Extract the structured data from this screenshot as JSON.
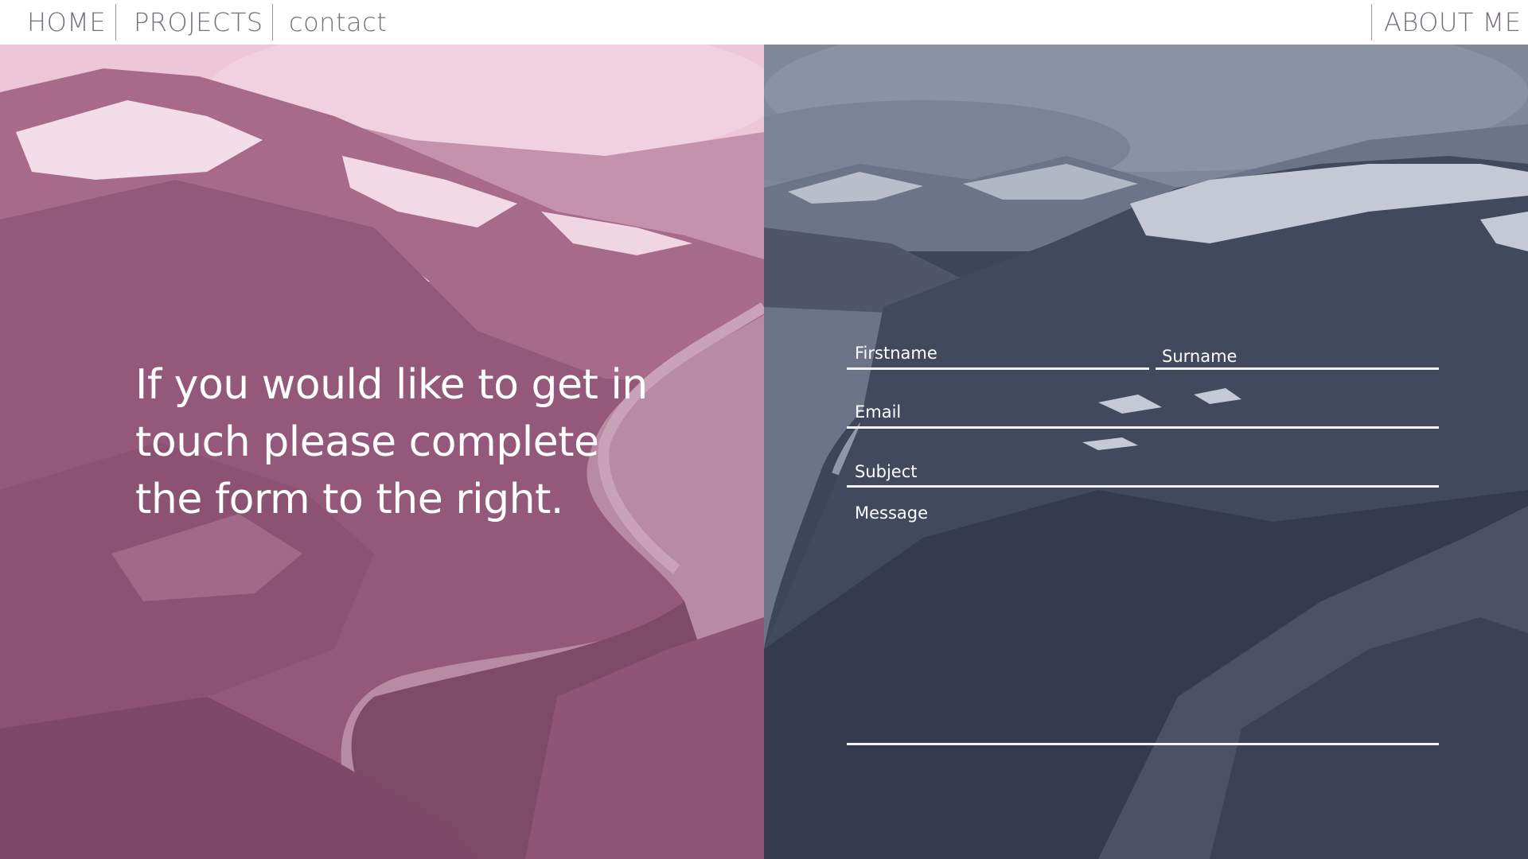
{
  "nav": {
    "home": "HOME",
    "projects": "PROJECTS",
    "contact": "contact",
    "about": "ABOUT ME"
  },
  "hero": {
    "intro_text": "If you would like to get in touch please complete the form to the right."
  },
  "form": {
    "firstname_label": "Firstname",
    "surname_label": "Surname",
    "email_label": "Email",
    "subject_label": "Subject",
    "message_label": "Message"
  },
  "colors": {
    "nav_text": "#77707a",
    "left_tint": "#8a4a6c",
    "right_tint": "#2a3346",
    "form_line": "#f2f2f4"
  }
}
